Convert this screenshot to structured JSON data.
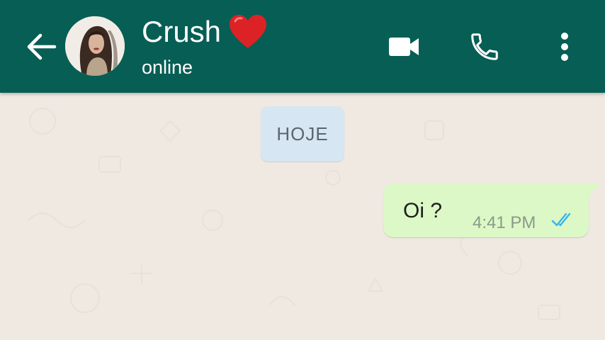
{
  "header": {
    "back_icon": "arrow-left-icon",
    "contact_name": "Crush",
    "name_emoji": "heart-icon",
    "status": "online",
    "video_icon": "video-camera-icon",
    "call_icon": "phone-icon",
    "menu_icon": "more-vertical-icon",
    "background_color": "#075e54"
  },
  "chat": {
    "date_label": "HOJE",
    "messages": [
      {
        "direction": "outgoing",
        "text": "Oi ?",
        "time": "4:41 PM",
        "status_icon": "double-check-read-icon",
        "bubble_color": "#dcf8c6",
        "tick_color": "#34b7f1"
      }
    ]
  }
}
